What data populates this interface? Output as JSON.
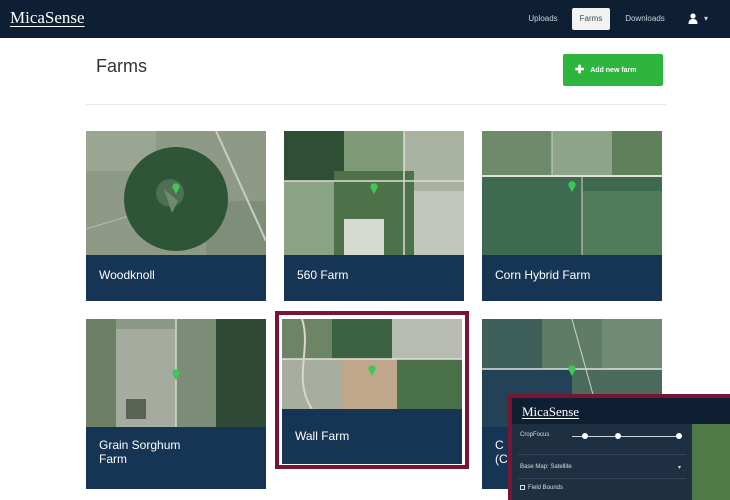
{
  "app": {
    "logo": "MicaSense"
  },
  "nav": {
    "items": [
      {
        "label": "Uploads"
      },
      {
        "label": "Farms",
        "active": true
      },
      {
        "label": "Downloads"
      }
    ],
    "user_menu_icon": "user-icon",
    "user_caret": "▾"
  },
  "page": {
    "title": "Farms",
    "add_button": {
      "label": "Add new farm",
      "icon": "plus-icon",
      "color": "#2db53e"
    }
  },
  "farms": [
    {
      "name": "Woodknoll"
    },
    {
      "name": "560 Farm"
    },
    {
      "name": "Corn Hybrid Farm"
    },
    {
      "name_line1": "Grain Sorghum",
      "name_line2": "Farm"
    },
    {
      "name": "Wall Farm",
      "highlighted": true
    },
    {
      "name_line1": "C",
      "name_line2": "(C"
    }
  ],
  "inset": {
    "logo": "MicaSense",
    "crop_focus_label": "CropFocus",
    "base_map_label": "Base Map: Satellite",
    "field_bounds_label": "Field Bounds"
  },
  "colors": {
    "navbar": "#0e1f33",
    "card_label": "#163454",
    "highlight": "#7a1433",
    "pin": "#3fc65a"
  }
}
